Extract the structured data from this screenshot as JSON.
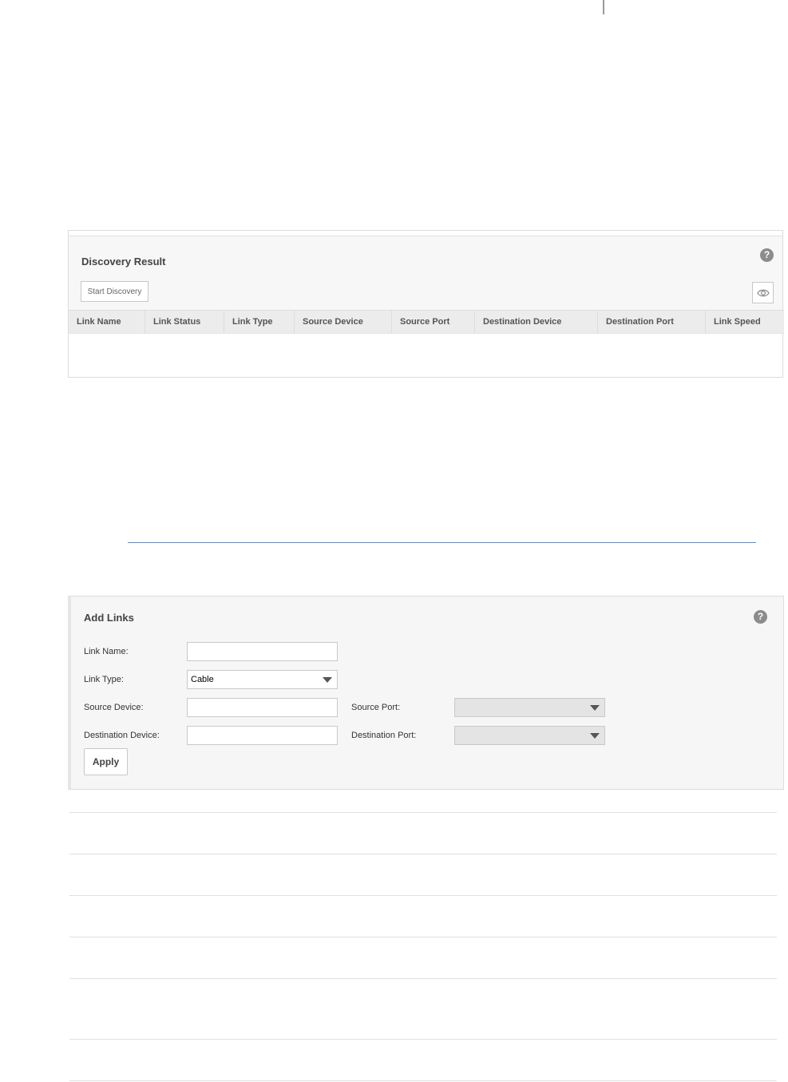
{
  "discovery": {
    "title": "Discovery Result",
    "help_symbol": "?",
    "start_label": "Start Discovery",
    "columns": [
      "Link Name",
      "Link Status",
      "Link Type",
      "Source Device",
      "Source Port",
      "Destination Device",
      "Destination Port",
      "Link Speed"
    ],
    "rows": []
  },
  "add_links": {
    "title": "Add Links",
    "help_symbol": "?",
    "link_name_label": "Link Name:",
    "link_name_value": "",
    "link_type_label": "Link Type:",
    "link_type_value": "Cable",
    "source_device_label": "Source Device:",
    "source_device_value": "",
    "source_port_label": "Source Port:",
    "source_port_value": "",
    "destination_device_label": "Destination Device:",
    "destination_device_value": "",
    "destination_port_label": "Destination Port:",
    "destination_port_value": "",
    "apply_label": "Apply"
  },
  "icons": {
    "help": "help-circle-icon",
    "eye": "eye-icon",
    "dropdown": "chevron-down-icon"
  },
  "colors": {
    "panel_bg": "#f7f7f7",
    "header_bg": "#ececec",
    "help_icon": "#8c8c8c",
    "rule_blue": "#6a8ab5"
  }
}
